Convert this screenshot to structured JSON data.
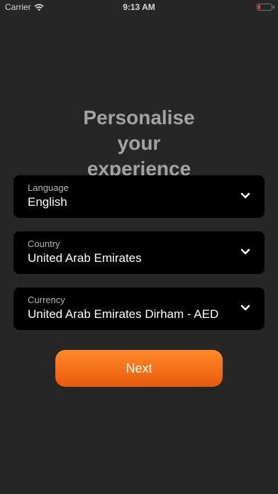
{
  "status_bar": {
    "carrier": "Carrier",
    "time": "9:13 AM",
    "wifi_icon": "wifi-icon",
    "battery_icon": "battery-low-icon",
    "battery_color": "#ff3b30"
  },
  "title": "Personalise your experience",
  "fields": [
    {
      "label": "Language",
      "value": "English",
      "icon": "chevron-down-icon"
    },
    {
      "label": "Country",
      "value": "United Arab Emirates",
      "icon": "chevron-down-icon"
    },
    {
      "label": "Currency",
      "value": "United Arab Emirates Dirham - AED",
      "icon": "chevron-down-icon"
    }
  ],
  "next_button": {
    "label": "Next"
  },
  "colors": {
    "background": "#262626",
    "card": "#000000",
    "accent_top": "#ff8a2a",
    "accent_bottom": "#e85a0c",
    "title": "#a3a3a3"
  }
}
